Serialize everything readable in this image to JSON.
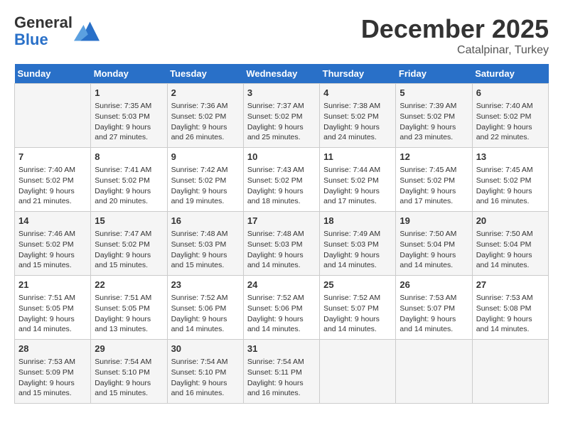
{
  "header": {
    "logo_general": "General",
    "logo_blue": "Blue",
    "month_title": "December 2025",
    "location": "Catalpinar, Turkey"
  },
  "weekdays": [
    "Sunday",
    "Monday",
    "Tuesday",
    "Wednesday",
    "Thursday",
    "Friday",
    "Saturday"
  ],
  "weeks": [
    [
      {
        "day": "",
        "info": ""
      },
      {
        "day": "1",
        "info": "Sunrise: 7:35 AM\nSunset: 5:03 PM\nDaylight: 9 hours\nand 27 minutes."
      },
      {
        "day": "2",
        "info": "Sunrise: 7:36 AM\nSunset: 5:02 PM\nDaylight: 9 hours\nand 26 minutes."
      },
      {
        "day": "3",
        "info": "Sunrise: 7:37 AM\nSunset: 5:02 PM\nDaylight: 9 hours\nand 25 minutes."
      },
      {
        "day": "4",
        "info": "Sunrise: 7:38 AM\nSunset: 5:02 PM\nDaylight: 9 hours\nand 24 minutes."
      },
      {
        "day": "5",
        "info": "Sunrise: 7:39 AM\nSunset: 5:02 PM\nDaylight: 9 hours\nand 23 minutes."
      },
      {
        "day": "6",
        "info": "Sunrise: 7:40 AM\nSunset: 5:02 PM\nDaylight: 9 hours\nand 22 minutes."
      }
    ],
    [
      {
        "day": "7",
        "info": "Sunrise: 7:40 AM\nSunset: 5:02 PM\nDaylight: 9 hours\nand 21 minutes."
      },
      {
        "day": "8",
        "info": "Sunrise: 7:41 AM\nSunset: 5:02 PM\nDaylight: 9 hours\nand 20 minutes."
      },
      {
        "day": "9",
        "info": "Sunrise: 7:42 AM\nSunset: 5:02 PM\nDaylight: 9 hours\nand 19 minutes."
      },
      {
        "day": "10",
        "info": "Sunrise: 7:43 AM\nSunset: 5:02 PM\nDaylight: 9 hours\nand 18 minutes."
      },
      {
        "day": "11",
        "info": "Sunrise: 7:44 AM\nSunset: 5:02 PM\nDaylight: 9 hours\nand 17 minutes."
      },
      {
        "day": "12",
        "info": "Sunrise: 7:45 AM\nSunset: 5:02 PM\nDaylight: 9 hours\nand 17 minutes."
      },
      {
        "day": "13",
        "info": "Sunrise: 7:45 AM\nSunset: 5:02 PM\nDaylight: 9 hours\nand 16 minutes."
      }
    ],
    [
      {
        "day": "14",
        "info": "Sunrise: 7:46 AM\nSunset: 5:02 PM\nDaylight: 9 hours\nand 15 minutes."
      },
      {
        "day": "15",
        "info": "Sunrise: 7:47 AM\nSunset: 5:02 PM\nDaylight: 9 hours\nand 15 minutes."
      },
      {
        "day": "16",
        "info": "Sunrise: 7:48 AM\nSunset: 5:03 PM\nDaylight: 9 hours\nand 15 minutes."
      },
      {
        "day": "17",
        "info": "Sunrise: 7:48 AM\nSunset: 5:03 PM\nDaylight: 9 hours\nand 14 minutes."
      },
      {
        "day": "18",
        "info": "Sunrise: 7:49 AM\nSunset: 5:03 PM\nDaylight: 9 hours\nand 14 minutes."
      },
      {
        "day": "19",
        "info": "Sunrise: 7:50 AM\nSunset: 5:04 PM\nDaylight: 9 hours\nand 14 minutes."
      },
      {
        "day": "20",
        "info": "Sunrise: 7:50 AM\nSunset: 5:04 PM\nDaylight: 9 hours\nand 14 minutes."
      }
    ],
    [
      {
        "day": "21",
        "info": "Sunrise: 7:51 AM\nSunset: 5:05 PM\nDaylight: 9 hours\nand 14 minutes."
      },
      {
        "day": "22",
        "info": "Sunrise: 7:51 AM\nSunset: 5:05 PM\nDaylight: 9 hours\nand 13 minutes."
      },
      {
        "day": "23",
        "info": "Sunrise: 7:52 AM\nSunset: 5:06 PM\nDaylight: 9 hours\nand 14 minutes."
      },
      {
        "day": "24",
        "info": "Sunrise: 7:52 AM\nSunset: 5:06 PM\nDaylight: 9 hours\nand 14 minutes."
      },
      {
        "day": "25",
        "info": "Sunrise: 7:52 AM\nSunset: 5:07 PM\nDaylight: 9 hours\nand 14 minutes."
      },
      {
        "day": "26",
        "info": "Sunrise: 7:53 AM\nSunset: 5:07 PM\nDaylight: 9 hours\nand 14 minutes."
      },
      {
        "day": "27",
        "info": "Sunrise: 7:53 AM\nSunset: 5:08 PM\nDaylight: 9 hours\nand 14 minutes."
      }
    ],
    [
      {
        "day": "28",
        "info": "Sunrise: 7:53 AM\nSunset: 5:09 PM\nDaylight: 9 hours\nand 15 minutes."
      },
      {
        "day": "29",
        "info": "Sunrise: 7:54 AM\nSunset: 5:10 PM\nDaylight: 9 hours\nand 15 minutes."
      },
      {
        "day": "30",
        "info": "Sunrise: 7:54 AM\nSunset: 5:10 PM\nDaylight: 9 hours\nand 16 minutes."
      },
      {
        "day": "31",
        "info": "Sunrise: 7:54 AM\nSunset: 5:11 PM\nDaylight: 9 hours\nand 16 minutes."
      },
      {
        "day": "",
        "info": ""
      },
      {
        "day": "",
        "info": ""
      },
      {
        "day": "",
        "info": ""
      }
    ]
  ]
}
